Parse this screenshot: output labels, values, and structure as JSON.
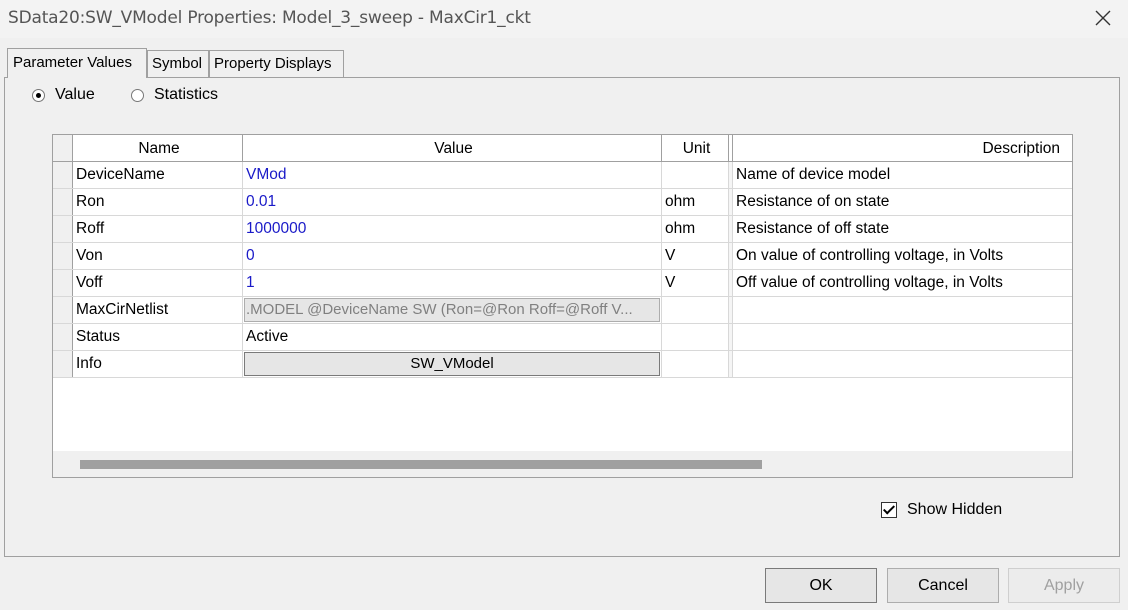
{
  "window": {
    "title": "SData20:SW_VModel Properties: Model_3_sweep - MaxCir1_ckt",
    "close_icon": "close-icon"
  },
  "tabs": [
    {
      "label": "Parameter Values",
      "active": true
    },
    {
      "label": "Symbol",
      "active": false
    },
    {
      "label": "Property Displays",
      "active": false
    }
  ],
  "view_mode": {
    "value_label": "Value",
    "statistics_label": "Statistics",
    "selected": "Value"
  },
  "table": {
    "columns": {
      "name": "Name",
      "value": "Value",
      "unit": "Unit",
      "description": "Description"
    },
    "rows": [
      {
        "name": "DeviceName",
        "value": "VMod",
        "unit": "",
        "description": "Name of device model",
        "value_style": "text-blue"
      },
      {
        "name": "Ron",
        "value": "0.01",
        "unit": "ohm",
        "description": "Resistance of on state",
        "value_style": "text-blue"
      },
      {
        "name": "Roff",
        "value": "1000000",
        "unit": "ohm",
        "description": "Resistance of off state",
        "value_style": "text-blue"
      },
      {
        "name": "Von",
        "value": "0",
        "unit": "V",
        "description": "On value of controlling voltage, in Volts",
        "value_style": "text-blue"
      },
      {
        "name": "Voff",
        "value": "1",
        "unit": "V",
        "description": "Off value of controlling voltage, in Volts",
        "value_style": "text-blue"
      },
      {
        "name": "MaxCirNetlist",
        "value": ".MODEL @DeviceName SW (Ron=@Ron Roff=@Roff V...",
        "unit": "",
        "description": "",
        "value_style": "button-disabled"
      },
      {
        "name": "Status",
        "value": "Active",
        "unit": "",
        "description": "",
        "value_style": "text"
      },
      {
        "name": "Info",
        "value": "SW_VModel",
        "unit": "",
        "description": "",
        "value_style": "button"
      }
    ],
    "horizontal_scroll_fraction": 0.67
  },
  "show_hidden": {
    "label": "Show Hidden",
    "checked": true
  },
  "buttons": {
    "ok": "OK",
    "cancel": "Cancel",
    "apply": "Apply",
    "apply_enabled": false
  },
  "colors": {
    "value_text": "#1a1ac8",
    "window_bg": "#f0f0f0",
    "disabled_text": "#a0a0a0"
  }
}
